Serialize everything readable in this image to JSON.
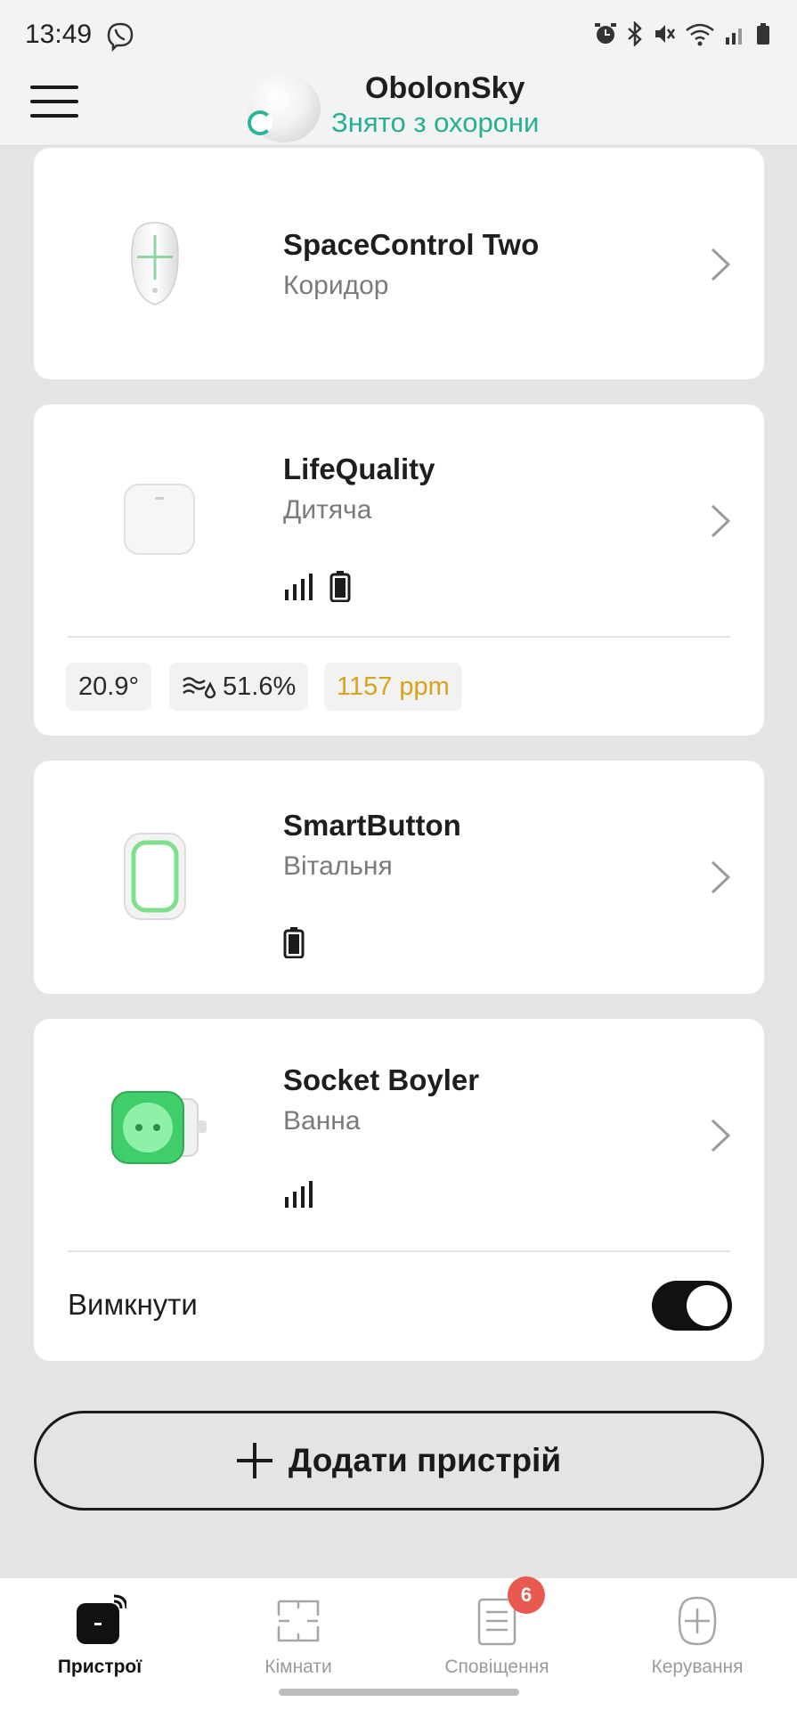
{
  "status_bar": {
    "time": "13:49",
    "icons": [
      "viber-icon",
      "alarm-icon",
      "bluetooth-icon",
      "mute-icon",
      "wifi-icon",
      "signal-icon",
      "battery-icon"
    ]
  },
  "header": {
    "hub_name": "ObolonSky",
    "hub_status": "Знято з охорони",
    "status_color": "#25b094"
  },
  "devices": [
    {
      "name": "SpaceControl Two",
      "room": "Коридор"
    },
    {
      "name": "LifeQuality",
      "room": "Дитяча",
      "metrics": {
        "temperature": "20.9°",
        "humidity": "51.6%",
        "co2": "1157 ppm"
      }
    },
    {
      "name": "SmartButton",
      "room": "Вітальня"
    },
    {
      "name": "Socket Boyler",
      "room": "Ванна",
      "toggle_label": "Вимкнути",
      "toggle_on": true
    }
  ],
  "add_device_label": "Додати пристрій",
  "bottom_nav": {
    "items": [
      {
        "label": "Пристрої",
        "active": true
      },
      {
        "label": "Кімнати"
      },
      {
        "label": "Сповіщення",
        "badge": "6"
      },
      {
        "label": "Керування"
      }
    ]
  },
  "colors": {
    "accent": "#25b094",
    "warning": "#d9a21b",
    "badge": "#e85a4f"
  }
}
